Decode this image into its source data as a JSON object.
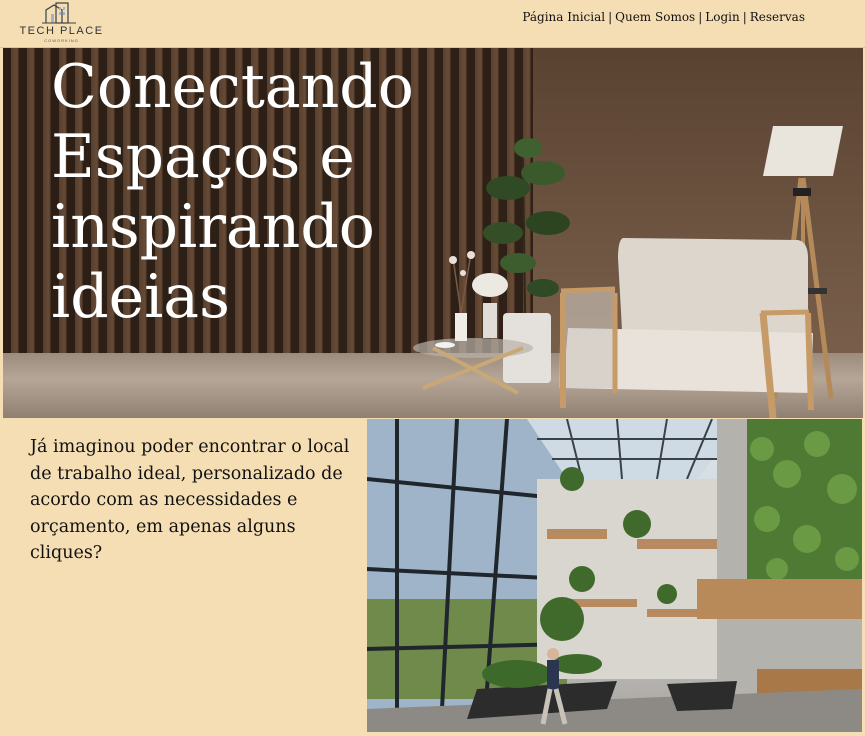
{
  "header": {
    "logo_text": "TECH PLACE",
    "logo_subtext": "COWORKING",
    "nav": [
      {
        "label": "Página Inicial"
      },
      {
        "label": "Quem Somos"
      },
      {
        "label": "Login"
      },
      {
        "label": "Reservas"
      }
    ]
  },
  "hero": {
    "title": "Conectando Espaços e inspirando ideias"
  },
  "intro": {
    "text": "Já imaginou poder encontrar o local de trabalho ideal, personalizado de acordo com as necessidades e orçamento, em apenas alguns cliques?"
  },
  "colors": {
    "background": "#f5deb3",
    "hero_text": "#ffffff",
    "body_text": "#111111"
  }
}
